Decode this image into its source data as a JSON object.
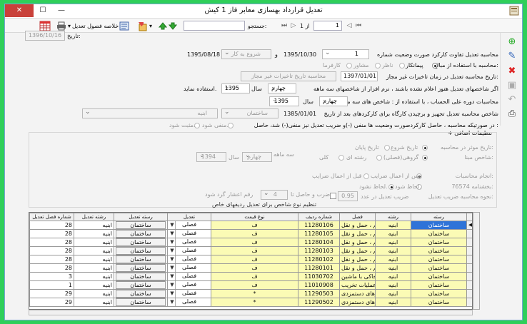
{
  "window": {
    "title": "تعدیل قرارداد بهسازی معابر فاز 1 کیش",
    "close": "✕",
    "max": "☐",
    "min": "—"
  },
  "toolbar": {
    "summary_label": "خلاصه فصول تعدیل",
    "search_label": "جستجو:",
    "page_label": "از 1",
    "page_value": "1",
    "search_value": ""
  },
  "date": {
    "label": "تاریخ:",
    "value": "1396/10/16"
  },
  "form": {
    "calc_label": "محاسبه تعدیل تفاوت کارکرد صورت وضعیت شماره",
    "statement_no": "1",
    "date1": "1395/10/30",
    "and_label": "و",
    "start_option": "شروع به کار",
    "date2": "1395/08/18",
    "amount_label": "محاسبه با استفاده از مبالغ:",
    "opt_contractor": "پیمانکار",
    "opt_supervisor": "ناظر",
    "opt_consultant": "مشاور",
    "opt_employer": "کارفرما",
    "time_label": "تاریخ محاسبه تعدیل در زمان تاخیرات غیر مجاز:",
    "time_date": "1397/01/01",
    "time_button": "محاسبه تاریخ تاخیرات غیر مجاز",
    "quarter_note": "اگر شاخصهای تعدیل هنوز اعلام نشده باشند ، نرم افزار از شاخصهای سه ماهه",
    "q_quarter": "چهارم",
    "q_year_label": "سال",
    "q_year": "1395",
    "q_suffix": "استفاده نماید.",
    "period_label": "محاسبات دوره علی الحساب ، با استفاده از : شاخص های سه ماهه",
    "p_quarter": "چهارم",
    "p_year_label": "سال",
    "p_year": "1395",
    "equip_label": "شاخص محاسبه تعدیل تجهیز و برچیدن کارگاه برای کارکردهای بعد از تاریخ",
    "equip_date": "1385/01/01",
    "equip_opt1": "ساختمان",
    "equip_opt2": "ابنیه",
    "neg_label": "در صورتیکه محاسبه ، حاصل کارکردصورت وضعیت ها منفی (-)و ضریب تعدیل نیز منفی(-) شد، حاصل :",
    "neg_opt1": "منفی شود.",
    "neg_opt2": "مثبت شود."
  },
  "advanced": {
    "title": "+ تنظیمات اضافی",
    "eff_label": "تاریخ موثر در محاسبه:",
    "eff_start": "تاریخ شروع",
    "eff_end": "تاریخ پایان",
    "basis_label": "شاخص مبنا:",
    "basis_group": "گروهی(فصلی)",
    "basis_row": "رشته ای",
    "basis_total": "کلی",
    "quarter_label": "سه ماهه",
    "b_quarter": "چهارم",
    "b_year_label": "سال",
    "b_year": "1394",
    "calc_mode_label": "انجام محاسبات:",
    "calc_after": "پس از اعمال ضرایب",
    "calc_before": "قبل از اعمال ضرایب",
    "circular_label": "بخشنامه 76574:",
    "circular_opt1": "لحاظ شود.",
    "circular_opt2": "لحاظ نشود.",
    "coef_label": "نحوه محاسبه ضریب تعدیل:",
    "coef_text": "ضریب تعدیل در عدد",
    "coef_value": "0.95",
    "coef_mid": "ضرب و حاصل تا",
    "coef_digits": "4",
    "coef_end": "رقم اعشار گرد شود",
    "row_type_link": "تنظیم نوع شاخص برای تعدیل ردیفهای خاص"
  },
  "grid": {
    "headers": [
      "رسته",
      "رشته",
      "فصل",
      "شماره ردیف",
      "نوع قیمت",
      "تعدیل",
      "رسته تعدیل",
      "رشته تعدیل",
      "شماره فصل تعدیل"
    ],
    "rows": [
      [
        "ساختمان",
        "ابنیه",
        "فصل بیست و هشتم ، حمل و نقل",
        "11280106",
        "ف",
        "فصلی",
        "ساختمان",
        "ابنیه",
        "28"
      ],
      [
        "ساختمان",
        "ابنیه",
        "فصل بیست و هشتم ، حمل و نقل",
        "11280105",
        "ف",
        "فصلی",
        "ساختمان",
        "ابنیه",
        "28"
      ],
      [
        "ساختمان",
        "ابنیه",
        "فصل بیست و هشتم ، حمل و نقل",
        "11280104",
        "ف",
        "فصلی",
        "ساختمان",
        "ابنیه",
        "28"
      ],
      [
        "ساختمان",
        "ابنیه",
        "فصل بیست و هشتم ، حمل و نقل",
        "11280103",
        "ف",
        "فصلی",
        "ساختمان",
        "ابنیه",
        "28"
      ],
      [
        "ساختمان",
        "ابنیه",
        "فصل بیست و هشتم ، حمل و نقل",
        "11280102",
        "ف",
        "فصلی",
        "ساختمان",
        "ابنیه",
        "28"
      ],
      [
        "ساختمان",
        "ابنیه",
        "فصل بیست و هشتم ، حمل و نقل",
        "11280101",
        "ف",
        "فصلی",
        "ساختمان",
        "ابنیه",
        "28"
      ],
      [
        "ساختمان",
        "ابنیه",
        "فصل سوم ، عملیات خاکی با ماشین",
        "11030702",
        "ف",
        "فصلی",
        "ساختمان",
        "ابنیه",
        "3"
      ],
      [
        "ساختمان",
        "ابنیه",
        "فصل اول ، عملیات تخریب",
        "11010908",
        "ف",
        "فصلی",
        "ساختمان",
        "ابنیه",
        "1"
      ],
      [
        "ساختمان",
        "ابنیه",
        "فصل بیست و نهم ،کارهای دستمزدی",
        "11290503",
        "*",
        "فصلی",
        "ساختمان",
        "ابنیه",
        "29"
      ],
      [
        "ساختمان",
        "ابنیه",
        "فصل بیست و نهم ،کارهای دستمزدی",
        "11290502",
        "*",
        "فصلی",
        "ساختمان",
        "ابنیه",
        "29"
      ]
    ]
  }
}
